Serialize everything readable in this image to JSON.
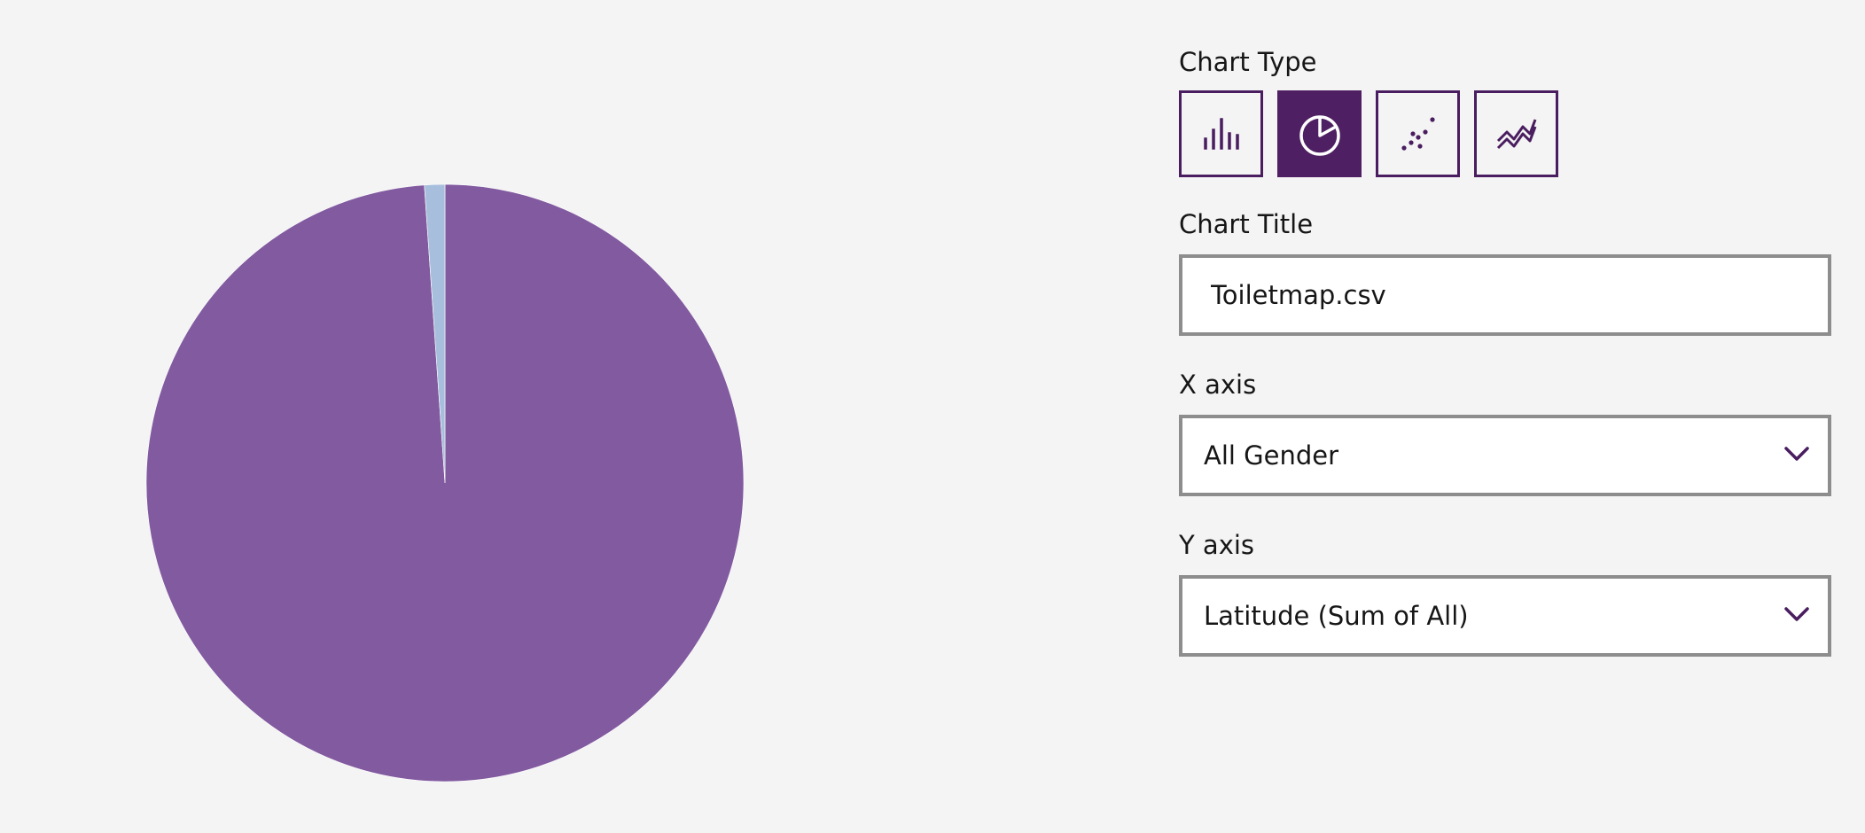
{
  "panel": {
    "chart_type_label": "Chart Type",
    "chart_types": [
      {
        "name": "bar-chart",
        "icon": "bar-chart-icon",
        "selected": false
      },
      {
        "name": "pie-chart",
        "icon": "pie-chart-icon",
        "selected": true
      },
      {
        "name": "scatter-chart",
        "icon": "scatter-chart-icon",
        "selected": false
      },
      {
        "name": "line-chart",
        "icon": "line-chart-icon",
        "selected": false
      }
    ],
    "chart_title_label": "Chart Title",
    "chart_title_value": "Toiletmap.csv",
    "x_axis_label": "X axis",
    "x_axis_value": "All Gender",
    "y_axis_label": "Y axis",
    "y_axis_value": "Latitude (Sum of All)"
  },
  "colors": {
    "accent": "#491d5f",
    "selected_bg": "#4f1f63",
    "slice_main": "#825aa0",
    "slice_small": "#a7bfdc",
    "background": "#f4f4f4"
  },
  "chart_data": {
    "type": "pie",
    "slices": [
      {
        "value": 98.9,
        "color": "#825aa0"
      },
      {
        "value": 1.1,
        "color": "#a7bfdc"
      }
    ]
  }
}
